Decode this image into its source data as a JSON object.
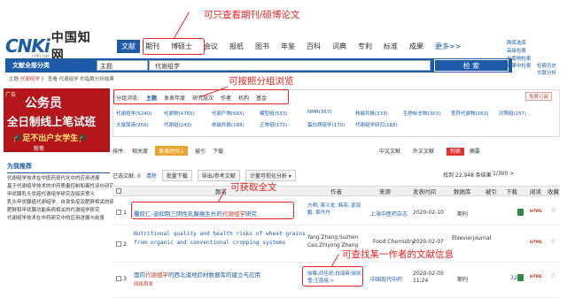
{
  "annotations": {
    "journal_thesis": "可只查看期刊/硕博论文",
    "group_browse": "可按照分组浏览",
    "full_text": "可获取全文",
    "coauthor": "可查找某一作者的文献信息"
  },
  "logo": {
    "main": "CNKi",
    "cn": "中国知网",
    "sub": "cnki.net"
  },
  "nav": {
    "items": [
      "文献",
      "期刊",
      "博硕士",
      "会议",
      "报纸",
      "图书",
      "年鉴",
      "百科",
      "词典",
      "专利",
      "标准",
      "成果",
      "更多>>"
    ]
  },
  "right_links": {
    "l1": "跨库选库",
    "l2": "高级检索",
    "l3": "出版物检索",
    "l4": "结果中检索",
    "l5": "检索历史",
    "l6": "文献分析"
  },
  "search": {
    "category": "文献全部分类",
    "field": "主题",
    "query": "代谢组学",
    "button": "检 索"
  },
  "breadcrumb": {
    "prefix": "主题:",
    "term": "代谢组学",
    "arrow": "》",
    "sub": "查看 代谢组学 的指数分析结果"
  },
  "ad": {
    "tag": "广告",
    "t1": "公务员",
    "t2": "全日制线上笔试班",
    "t3": "🎓足不出户女学生🎓",
    "t4": "粉笔"
  },
  "recommend": {
    "title": "为我推荐",
    "items": [
      "代谢组学技术在中医药现代化中的应用进展",
      "基于代谢组学技术的中药质量控制和毒性评价研究进展",
      "甲状腺乳头状癌代谢组学研究及临床意义",
      "乳头甲状腺癌代谢组学、自身免疫及肥胖相关的研究",
      "肥胖和甲状腺功能疾病相关的代谢组学研究",
      "代谢组学技术在中药研究中的应用进展与前景"
    ]
  },
  "grouping": {
    "label": "分组浏览:",
    "tabs": [
      "主题",
      "发表年度",
      "研究层次",
      "作者",
      "机构",
      "基金"
    ],
    "free": "免费订阅",
    "row1": [
      "代谢组学(5240)",
      "代谢物(4765)",
      "代谢产物(665)",
      "模型组(533)",
      "NMR(367)",
      "核磁共振(333)",
      "生物标志物(303)",
      "差异代谢物(263)",
      "对照组(257)"
    ],
    "row2": [
      "大鼠尿液(256)",
      "代谢组(243)",
      "核磁共振(188)",
      "正常组(172)",
      "蛋白质组学(170)",
      "代谢组学研究(168)"
    ]
  },
  "sortbar": {
    "label": "排序:",
    "items": [
      "相关度",
      "发表时间↓",
      "被引",
      "下载"
    ],
    "right": [
      "中文文献",
      "外文文献",
      "列表",
      "摘要",
      "每页显示: 10 20 50"
    ]
  },
  "opbar": {
    "selected": "已选文献: 0",
    "clear": "清除",
    "batch": "批量下载",
    "export": "导出/参考文献",
    "visual": "计量可视化分析 ▾",
    "count": "找到 22,948 条结果",
    "page": "1/300 >"
  },
  "table": {
    "headers": [
      "题名",
      "作者",
      "来源",
      "发表时间",
      "数据库",
      "被引",
      "下载",
      "阅读",
      "收藏"
    ],
    "rows": [
      {
        "no": "1",
        "title_pre": "覆叹仁-迪抑制三阴性乳腺癌生长的",
        "title_hl": "代谢组学",
        "title_post": "研究",
        "authors": "方明; 蒋义龙; 韩亮; 郭润鹏; 章丹丹",
        "source": "上海中医药杂志",
        "date": "2020-02-10",
        "db": "期刊",
        "cited": "",
        "dl": ""
      },
      {
        "no": "2",
        "title_pre": "Nutritional quality and health risks of wheat grains from organic and conventional cropping systems",
        "title_hl": "",
        "title_post": "",
        "authors": "Yang Zhang;Suzhen Cao;Zhiyong Zhang",
        "source": "Food Chemistry",
        "date": "2020-02-07",
        "db": "Elsevierjournal",
        "cited": "",
        "dl": ""
      },
      {
        "no": "3",
        "title_pre": "面向",
        "title_hl": "代谢组学",
        "title_post": "的西北道地药材数据库的建立与应用",
        "badge": "网络首发",
        "authors": "徐幂;邓佳凯;白海英;徐凯雪;王菡瑶 >",
        "source": "中国现代中药",
        "date": "2020-02-05 11:24",
        "db": "期刊",
        "cited": "",
        "dl": "32"
      }
    ],
    "html_label": "HTML"
  }
}
